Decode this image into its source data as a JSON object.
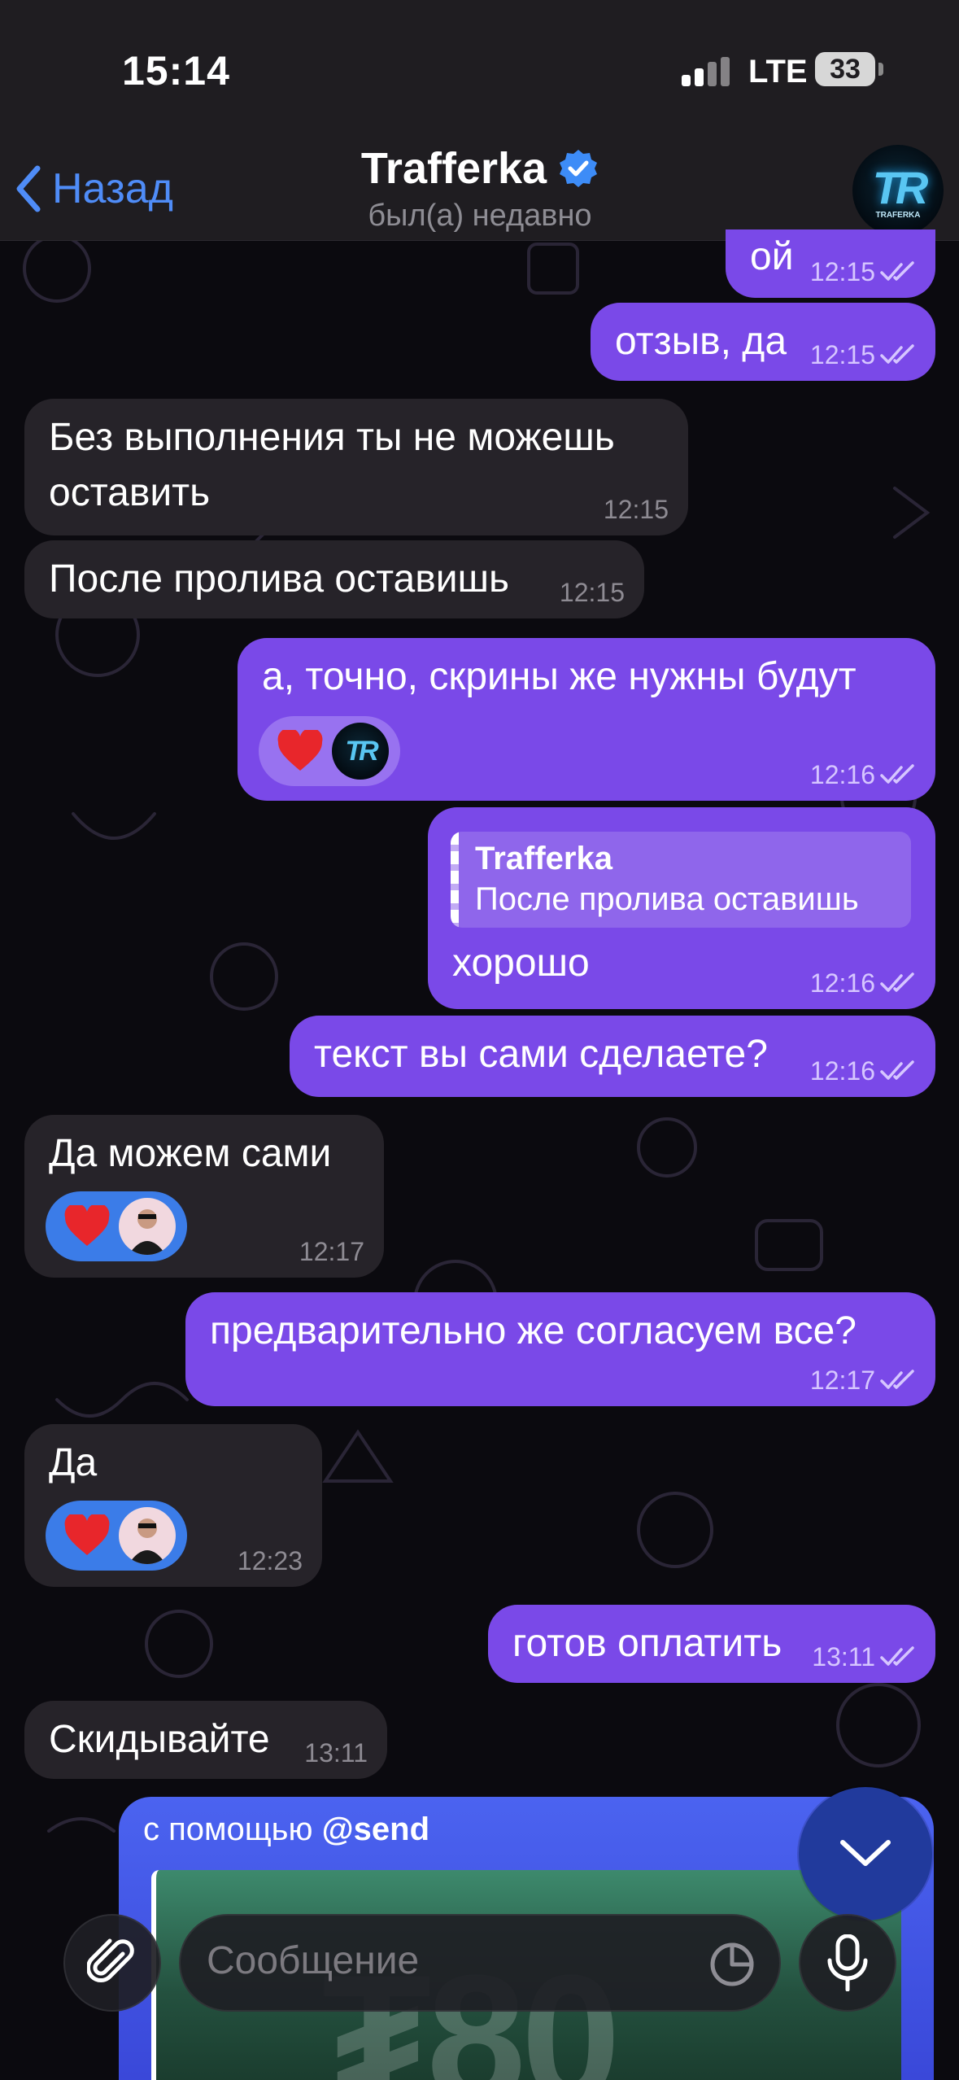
{
  "status_bar": {
    "time": "15:14",
    "network": "LTE",
    "battery": "33"
  },
  "header": {
    "back_label": "Назад",
    "title": "Trafferka",
    "subtitle": "был(а) недавно",
    "avatar_logo": "TR",
    "avatar_caption": "TRAFERKA"
  },
  "messages": [
    {
      "dir": "out",
      "text": "ой",
      "time": "12:15"
    },
    {
      "dir": "out",
      "text": "отзыв, да",
      "time": "12:15"
    },
    {
      "dir": "in",
      "text": "Без выполнения ты не можешь оставить",
      "time": "12:15"
    },
    {
      "dir": "in",
      "text": "После пролива оставишь",
      "time": "12:15"
    },
    {
      "dir": "out",
      "text": "а, точно, скрины же нужны будут",
      "time": "12:16",
      "reactions": [
        "heart",
        "TR"
      ]
    },
    {
      "dir": "out",
      "reply_name": "Trafferka",
      "reply_text": "После пролива оставишь",
      "text": "хорошо",
      "time": "12:16"
    },
    {
      "dir": "out",
      "text": "текст вы сами сделаете?",
      "time": "12:16"
    },
    {
      "dir": "in",
      "text": "Да можем сами",
      "time": "12:17",
      "reactions": [
        "heart",
        "person"
      ]
    },
    {
      "dir": "out",
      "text": "предварительно же согласуем все?",
      "time": "12:17"
    },
    {
      "dir": "in",
      "text": "Да",
      "time": "12:23",
      "reactions": [
        "heart",
        "person"
      ]
    },
    {
      "dir": "out",
      "text": "готов оплатить",
      "time": "13:11"
    },
    {
      "dir": "in",
      "text": "Скидывайте",
      "time": "13:11"
    }
  ],
  "payment": {
    "via_label": "с помощью",
    "bot": "@send",
    "amount": "₮80"
  },
  "composer": {
    "placeholder": "Сообщение"
  },
  "colors": {
    "outgoing": "#7a49e8",
    "incoming": "#262329",
    "accent": "#4f8cf7",
    "reaction_in": "#3b7ce8"
  },
  "icons": [
    "back-chevron-icon",
    "verified-icon",
    "double-check-icon",
    "heart-icon",
    "paperclip-icon",
    "sticker-icon",
    "microphone-icon",
    "chevron-down-icon"
  ]
}
